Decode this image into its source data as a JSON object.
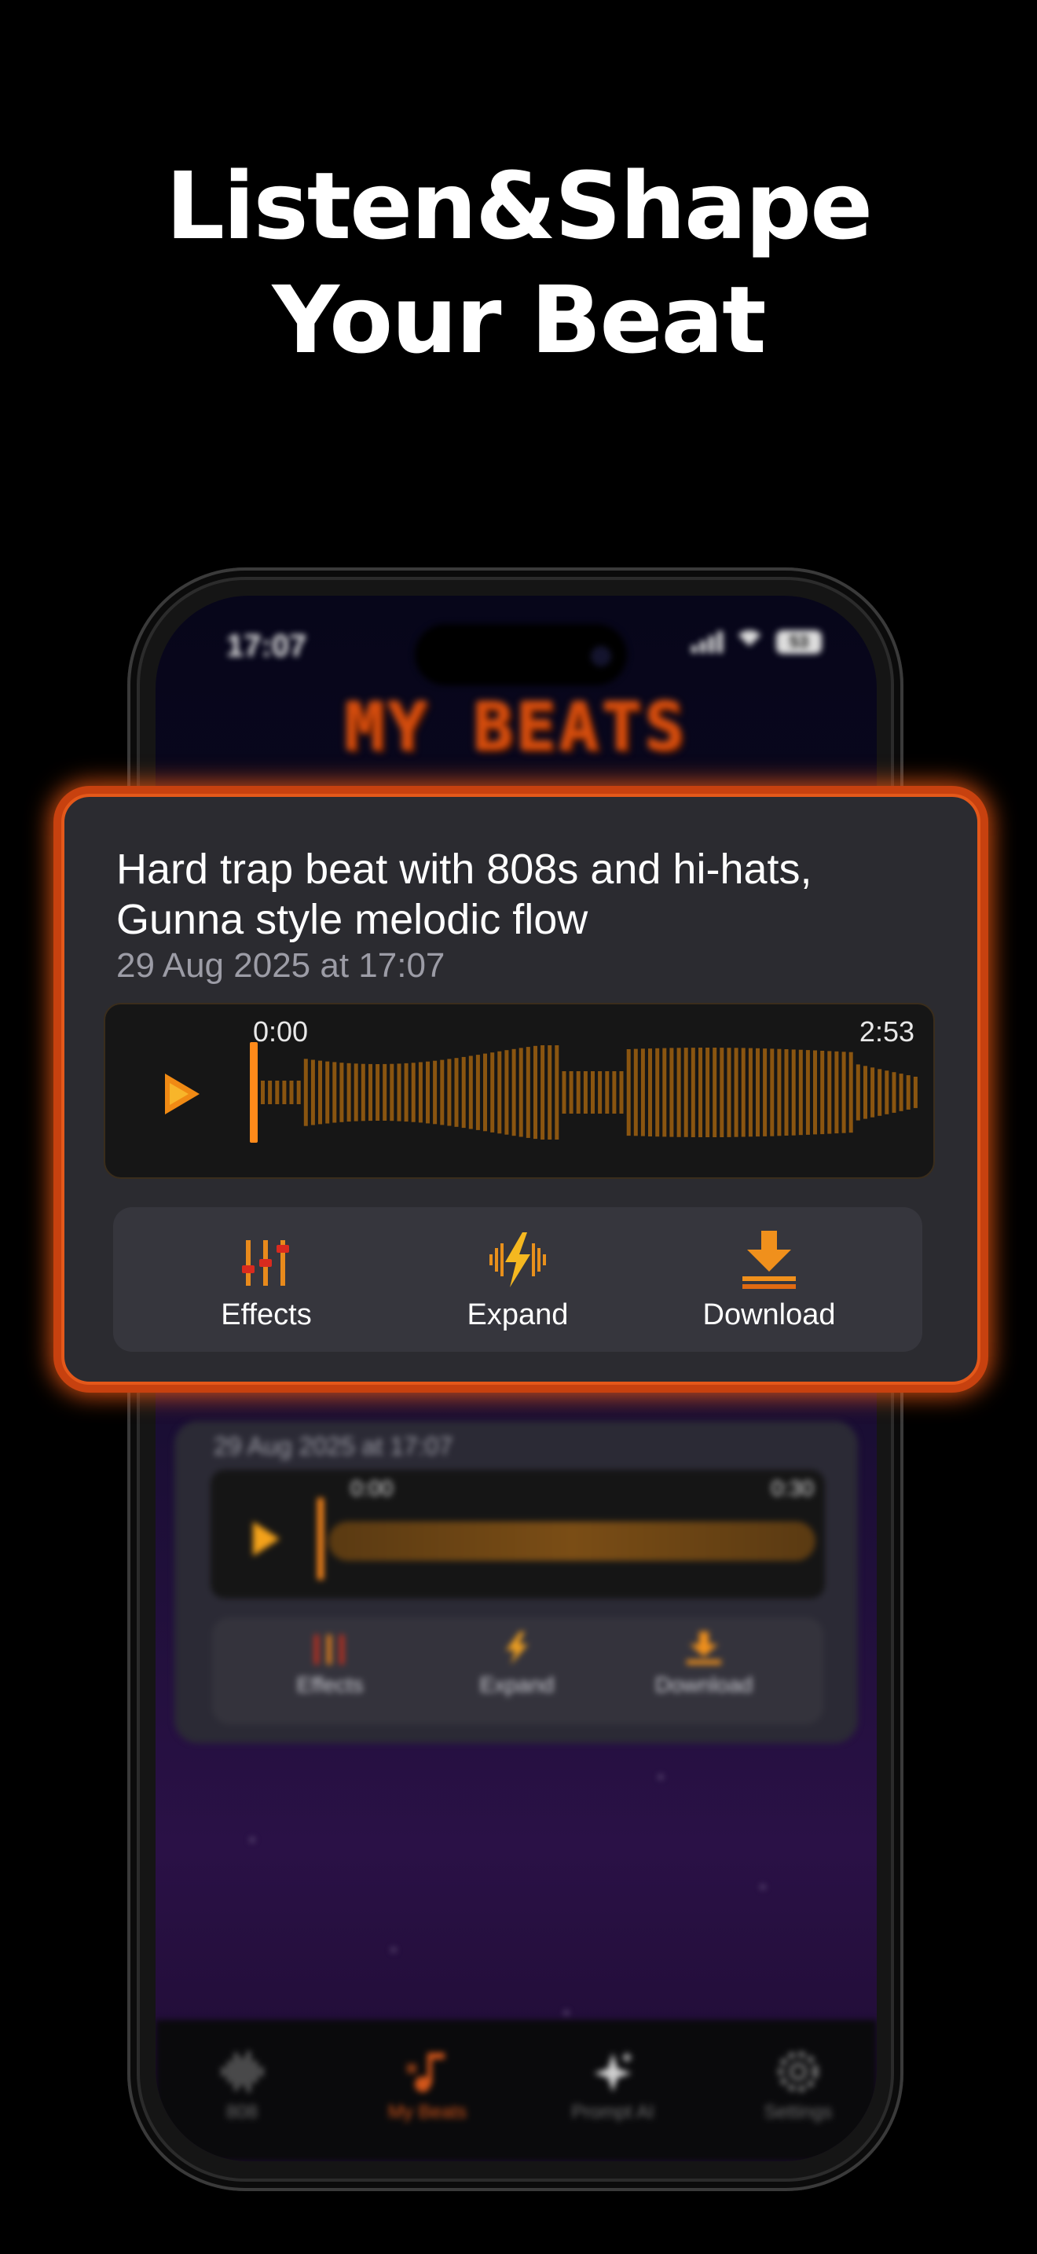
{
  "headline": {
    "line1": "Listen&Shape",
    "line2": "Your Beat"
  },
  "status_bar": {
    "time": "17:07",
    "battery": "53"
  },
  "app": {
    "title": "MY BEATS"
  },
  "focused_beat": {
    "title": "Hard trap beat with 808s and hi-hats, Gunna style melodic flow",
    "date": "29 Aug 2025 at 17:07",
    "time_current": "0:00",
    "time_total": "2:53",
    "playback_progress": 0,
    "play_icon": "play-icon",
    "actions": [
      {
        "label": "Effects",
        "icon": "equalizer-sliders-icon"
      },
      {
        "label": "Expand",
        "icon": "lightning-wave-icon"
      },
      {
        "label": "Download",
        "icon": "download-arrow-icon"
      }
    ]
  },
  "background_beat": {
    "date": "29 Aug 2025 at 17:07",
    "time_current": "0:00",
    "time_total": "0:30",
    "actions": [
      {
        "label": "Effects"
      },
      {
        "label": "Expand"
      },
      {
        "label": "Download"
      }
    ]
  },
  "tabs": [
    {
      "label": "808",
      "icon": "waveform-icon",
      "active": false
    },
    {
      "label": "My Beats",
      "icon": "music-note-icon",
      "active": true
    },
    {
      "label": "Prompt AI",
      "icon": "sparkles-icon",
      "active": false
    },
    {
      "label": "Settings",
      "icon": "gear-icon",
      "active": false
    }
  ],
  "colors": {
    "accent": "#e4581a",
    "wave": "#8a5510",
    "playhead": "#ff8a1a",
    "card": "#2b2b30"
  }
}
